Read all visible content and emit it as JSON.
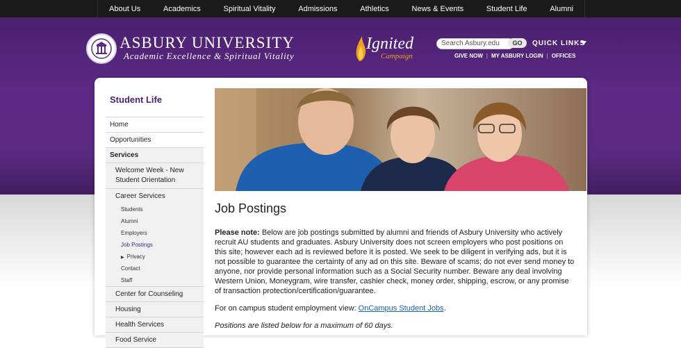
{
  "topnav": [
    "About Us",
    "Academics",
    "Spiritual Vitality",
    "Admissions",
    "Athletics",
    "News & Events",
    "Student Life",
    "Alumni"
  ],
  "logo": {
    "title": "ASBURY UNIVERSITY",
    "subtitle": "Academic Excellence & Spiritual Vitality"
  },
  "campaign": {
    "title": "Ignited",
    "subtitle": "Campaign"
  },
  "search": {
    "placeholder": "Search Asbury.edu",
    "go": "GO"
  },
  "quick_links": "QUICK LINKS",
  "utility_links": [
    "GIVE NOW",
    "MY ASBURY LOGIN",
    "OFFICES"
  ],
  "sidebar": {
    "title": "Student Life",
    "items": [
      "Home",
      "Opportunities"
    ],
    "section": "Services",
    "services": [
      "Welcome Week - New Student Orientation",
      "Career Services"
    ],
    "career": [
      "Students",
      "Alumni",
      "Employers",
      "Job Postings",
      "Privacy",
      "Contact",
      "Staff"
    ],
    "more": [
      "Center for Counseling",
      "Housing",
      "Health Services",
      "Food Service"
    ]
  },
  "main": {
    "title": "Job Postings",
    "note_label": "Please note:",
    "note_text": " Below are job postings submitted by alumni and friends of Asbury University who actively recruit AU students and graduates. Asbury University does not screen employers who post positions on this site; however each ad is reviewed before it is posted. We seek to be diligent in verifying ads, but it is not possible to guarantee the certainty of any ad on this site. Beware of scams; do not ever send money to anyone, nor provide personal information such as a Social Security number. Beware any deal involving Western Union, Moneygram, wire transfer, cashier check, money order, shipping, escrow, or any promise of transaction protection/certification/guarantee.",
    "campus_prefix": "For on campus student employment view: ",
    "campus_link": "OnCampus Student Jobs",
    "campus_suffix": ".",
    "duration": "Positions are listed below for a maximum of 60 days."
  }
}
